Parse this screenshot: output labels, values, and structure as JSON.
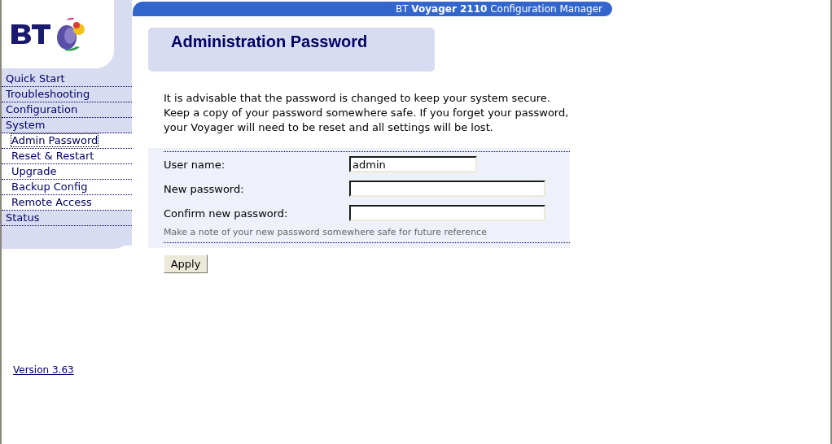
{
  "header": {
    "title": "BT **Voyager 2110** Configuration Manager"
  },
  "nav": [
    {
      "label": "Quick Start",
      "selected": false
    },
    {
      "label": "Troubleshooting",
      "selected": false
    },
    {
      "label": "Configuration",
      "selected": false
    },
    {
      "label": "System",
      "selected": false,
      "children": [
        {
          "label": "Admin Password",
          "selected": true
        },
        {
          "label": "Reset & Restart",
          "selected": false
        },
        {
          "label": "Upgrade",
          "selected": false
        },
        {
          "label": "Backup Config",
          "selected": false
        },
        {
          "label": "Remote Access",
          "selected": false
        }
      ]
    },
    {
      "label": "Status",
      "selected": false
    }
  ],
  "version": "Version 3.63",
  "page_title": "Administration Password",
  "intro": [
    "It is advisable that the password is changed to keep your system secure.",
    "Keep a copy of your password somewhere safe. If you forget your password,",
    "your Voyager will need to be reset and all settings will be lost."
  ],
  "form": {
    "fields": [
      {
        "label": "User name:",
        "value": "admin",
        "kind": "short"
      },
      {
        "label": "New password:",
        "kind": "long"
      },
      {
        "label": "Confirm new password:",
        "kind": "long"
      }
    ],
    "hint": "Make a note of your new password somewhere safe for future reference",
    "button": "Apply"
  }
}
